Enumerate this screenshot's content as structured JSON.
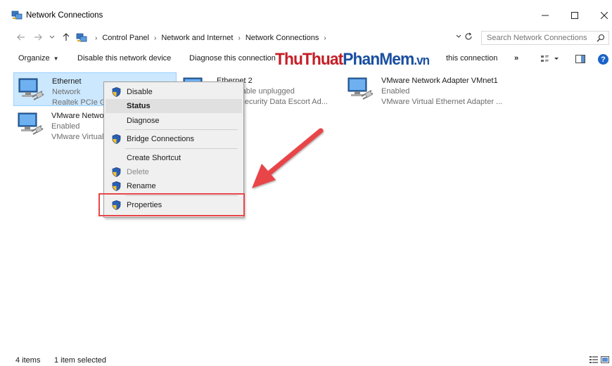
{
  "window": {
    "title": "Network Connections",
    "minimize": "—",
    "maximize": "☐",
    "close": "✕"
  },
  "address": {
    "crumbs": [
      "Control Panel",
      "Network and Internet",
      "Network Connections"
    ],
    "search_placeholder": "Search Network Connections"
  },
  "toolbar": {
    "organize": "Organize",
    "disable": "Disable this network device",
    "diagnose": "Diagnose this connection",
    "rename": "this connection",
    "more": "»"
  },
  "watermark": {
    "part1": "Thu",
    "part2": "Thuat",
    "part3": "Phan",
    "part4": "Mem",
    "part5": ".vn"
  },
  "connections": [
    {
      "name": "Ethernet",
      "status": "Network",
      "device": "Realtek PCIe GB"
    },
    {
      "name": "Ethernet 2",
      "status": "t cable unplugged",
      "device": "y Security Data Escort Ad..."
    },
    {
      "name": "VMware Network Adapter VMnet1",
      "status": "Enabled",
      "device": "VMware Virtual Ethernet Adapter ..."
    },
    {
      "name": "VMware Netwo",
      "status": "Enabled",
      "device": "VMware Virtual"
    }
  ],
  "context_menu": {
    "disable": "Disable",
    "status": "Status",
    "diagnose": "Diagnose",
    "bridge": "Bridge Connections",
    "shortcut": "Create Shortcut",
    "delete": "Delete",
    "rename": "Rename",
    "properties": "Properties"
  },
  "statusbar": {
    "items": "4 items",
    "selected": "1 item selected"
  },
  "colors": {
    "selection": "#cce8ff",
    "highlight_box": "#e8454a",
    "arrow": "#e8454a"
  }
}
